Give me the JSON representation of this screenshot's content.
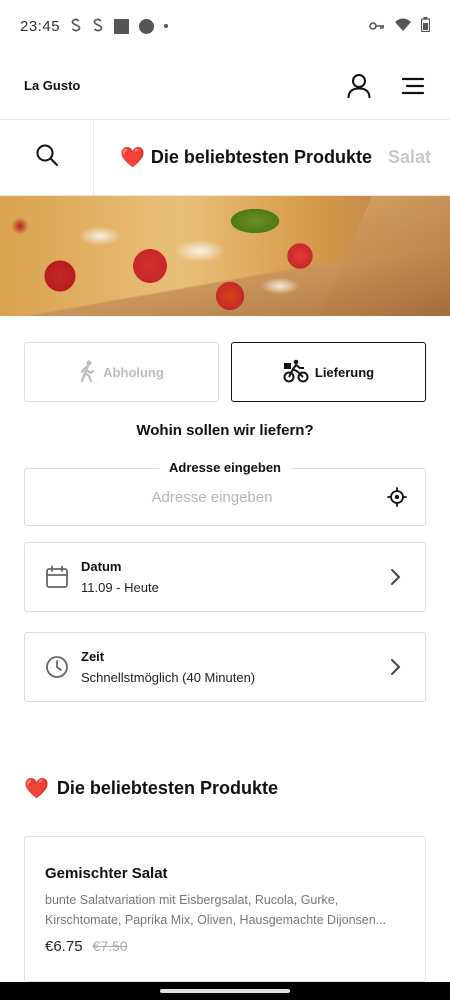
{
  "status_bar": {
    "time": "23:45",
    "icons": [
      "s-notification-icon",
      "s-notification-icon",
      "square-notification-icon",
      "circle-notification-icon",
      "dot-icon",
      "vpn-key-icon",
      "wifi-icon",
      "battery-icon"
    ]
  },
  "header": {
    "brand": "La Gusto",
    "icons": [
      "user-icon",
      "menu-icon"
    ]
  },
  "category_bar": {
    "search_icon": "search-icon",
    "tabs": [
      {
        "label": "Die beliebtesten Produkte",
        "active": true,
        "icon": "heart-icon"
      },
      {
        "label": "Salat",
        "active": false
      }
    ]
  },
  "hero": {
    "image": "pizza-banner"
  },
  "order_mode": {
    "pickup_label": "Abholung",
    "delivery_label": "Lieferung",
    "selected": "delivery"
  },
  "delivery": {
    "question": "Wohin sollen wir liefern?",
    "address_legend": "Adresse eingeben",
    "address_placeholder": "Adresse eingeben",
    "address_value": ""
  },
  "date": {
    "title": "Datum",
    "value": "11.09 - Heute"
  },
  "time": {
    "title": "Zeit",
    "value": "Schnellstmöglich (40 Minuten)"
  },
  "section": {
    "title": "Die beliebtesten Produkte"
  },
  "products": [
    {
      "name": "Gemischter Salat",
      "description": "bunte Salatvariation mit Eisbergsalat, Rucola, Gurke, Kirschtomate, Paprika Mix, Oliven, Hausgemachte Dijonsen...",
      "price": "€6.75",
      "old_price": "€7.50"
    }
  ],
  "colors": {
    "accent": "#111111",
    "heart": "#e53935",
    "muted": "#bcbcbc"
  }
}
